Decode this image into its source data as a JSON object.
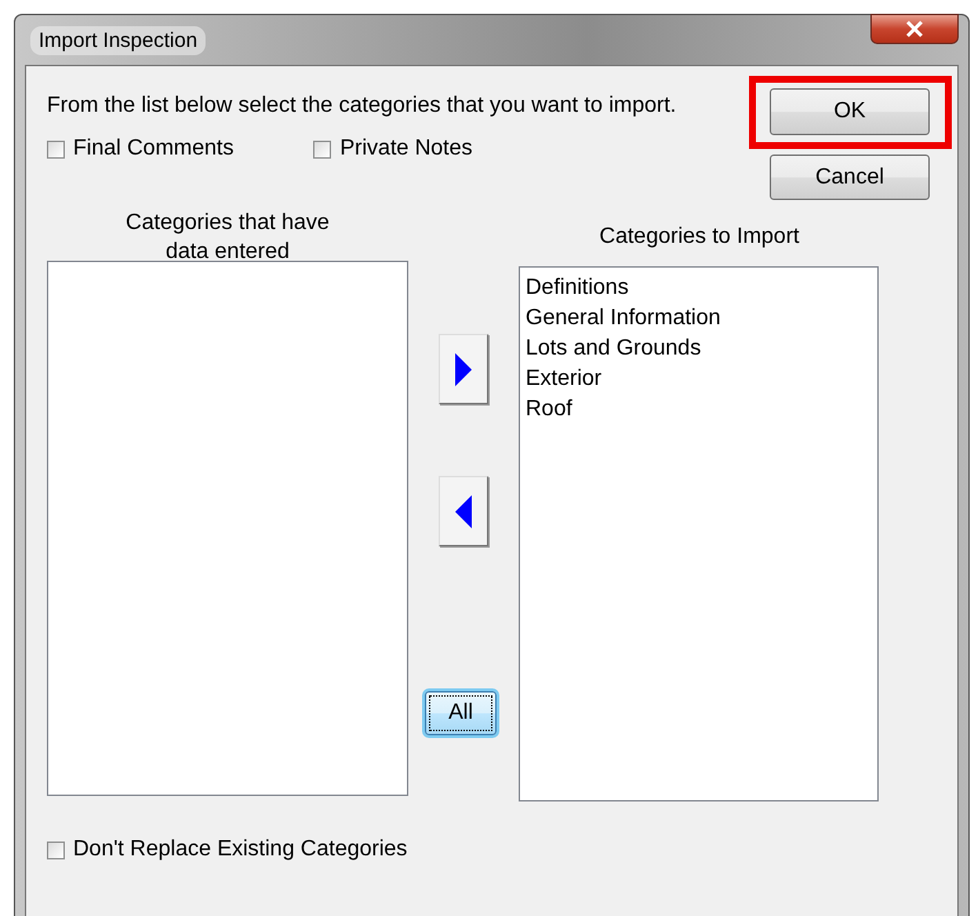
{
  "window": {
    "title": "Import Inspection"
  },
  "instruction": "From the list below select the categories that you want to import.",
  "buttons": [
    {
      "label": "OK",
      "highlighted": true
    },
    {
      "label": "Cancel",
      "highlighted": false
    }
  ],
  "options": [
    {
      "label": "Final Comments",
      "checked": false
    },
    {
      "label": "Private Notes",
      "checked": false
    }
  ],
  "source_list": {
    "heading": "Categories that have data entered"
  },
  "target_list": {
    "heading": "Categories to Import",
    "items": [
      "Definitions",
      "General Information",
      "Lots and Grounds",
      "Exterior",
      "Roof"
    ]
  },
  "move_buttons": [
    {
      "kind": "right"
    },
    {
      "kind": "left"
    }
  ],
  "all_button": {
    "label": "All",
    "focused": true
  },
  "replace_option": {
    "label": "Don't Replace Existing Categories",
    "checked": false
  }
}
